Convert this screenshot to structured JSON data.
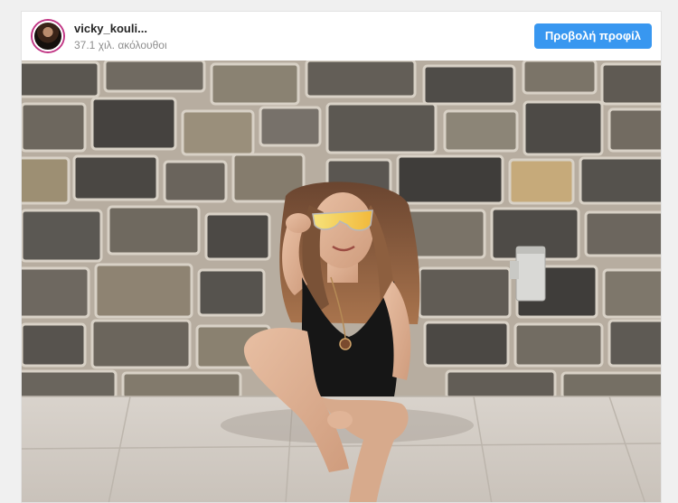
{
  "post": {
    "username": "vicky_kouli...",
    "followers": "37.1 χιλ. ακόλουθοι",
    "view_profile_label": "Προβολή προφίλ"
  },
  "icons": {
    "avatar": "profile-photo-avatar"
  },
  "colors": {
    "accent": "#3897f0",
    "avatar_ring": "#c13584",
    "username": "#262626",
    "secondary_text": "#8e8e8e"
  }
}
